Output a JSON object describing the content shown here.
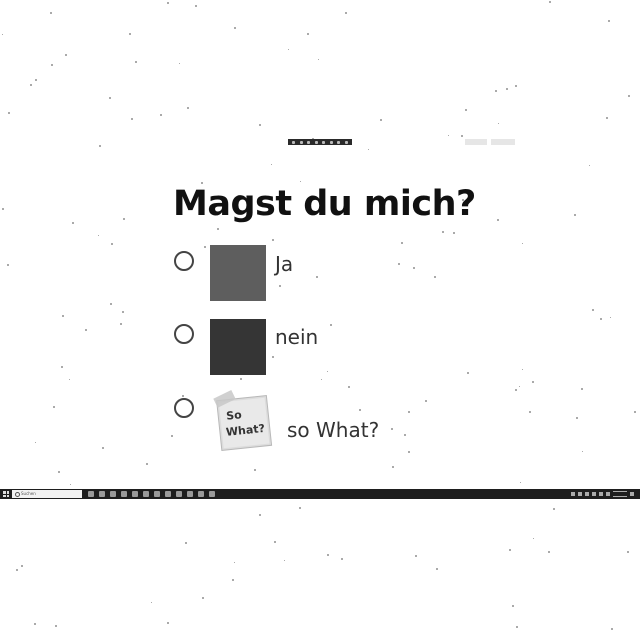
{
  "question": {
    "title": "Magst du mich?"
  },
  "options": [
    {
      "label": "Ja",
      "swatch_color": "#5e5e5e",
      "selected": false
    },
    {
      "label": "nein",
      "swatch_color": "#353535",
      "selected": false
    },
    {
      "label": "so What?",
      "image": "sticky-note-so-what",
      "image_text_1": "So",
      "image_text_2": "What?",
      "selected": false
    }
  ],
  "taskbar": {
    "search_label": "Suchen"
  },
  "colors": {
    "title": "#111111",
    "label": "#333333",
    "taskbar": "#1e1e1e"
  }
}
